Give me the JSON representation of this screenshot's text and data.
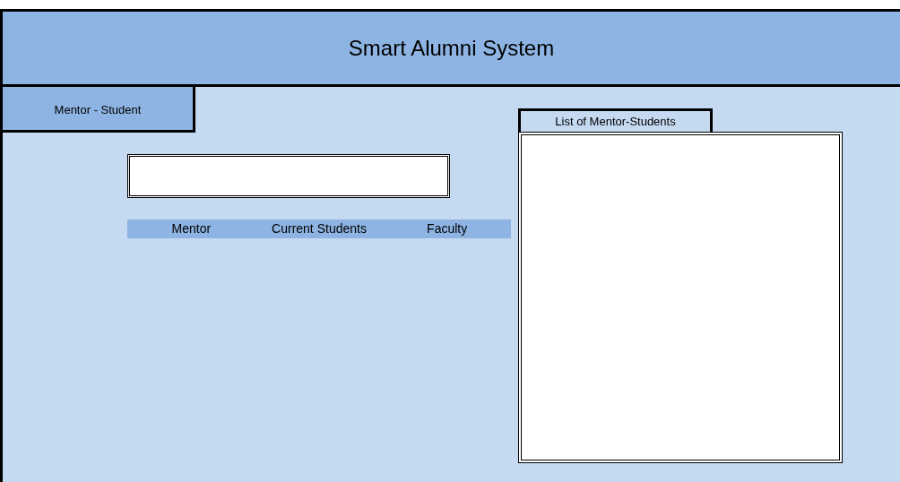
{
  "header": {
    "title": "Smart Alumni System"
  },
  "tab": {
    "label": "Mentor - Student"
  },
  "table": {
    "columns": [
      "Mentor",
      "Current Students",
      "Faculty"
    ]
  },
  "list_panel": {
    "title": "List of Mentor-Students"
  }
}
